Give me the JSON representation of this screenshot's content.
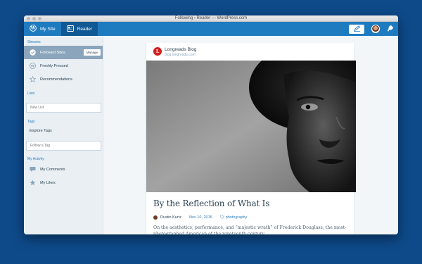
{
  "window": {
    "title": "Following ‹ Reader — WordPress.com"
  },
  "masterbar": {
    "my_site_label": "My Site",
    "reader_label": "Reader",
    "accent": "#1f7bc0",
    "active_bg": "#115994"
  },
  "sidebar": {
    "streams_label": "Streams",
    "streams": [
      {
        "label": "Followed Sites",
        "icon": "check-circle-icon",
        "selected": true
      },
      {
        "label": "Freshly Pressed",
        "icon": "wordpress-icon"
      },
      {
        "label": "Recommendations",
        "icon": "star-outline-icon"
      }
    ],
    "manage_label": "Manage",
    "lists_label": "Lists",
    "new_list_placeholder": "New List",
    "tags_label": "Tags",
    "explore_tags_label": "Explore Tags",
    "follow_tag_placeholder": "Follow a Tag",
    "activity_label": "My Activity",
    "activity": [
      {
        "label": "My Comments",
        "icon": "comment-icon"
      },
      {
        "label": "My Likes",
        "icon": "star-filled-icon"
      }
    ]
  },
  "post": {
    "site_initial": "L",
    "site_name": "Longreads Blog",
    "site_url": "blog.longreads.com",
    "title": "By the Reflection of What Is",
    "author": "Dustin Kurtz",
    "date": "Nov 10, 2015",
    "tag": "photography",
    "excerpt": "On the aesthetics, performance, and “majestic wrath” of Frederick Douglass, the most-photographed American of the nineteenth century."
  }
}
